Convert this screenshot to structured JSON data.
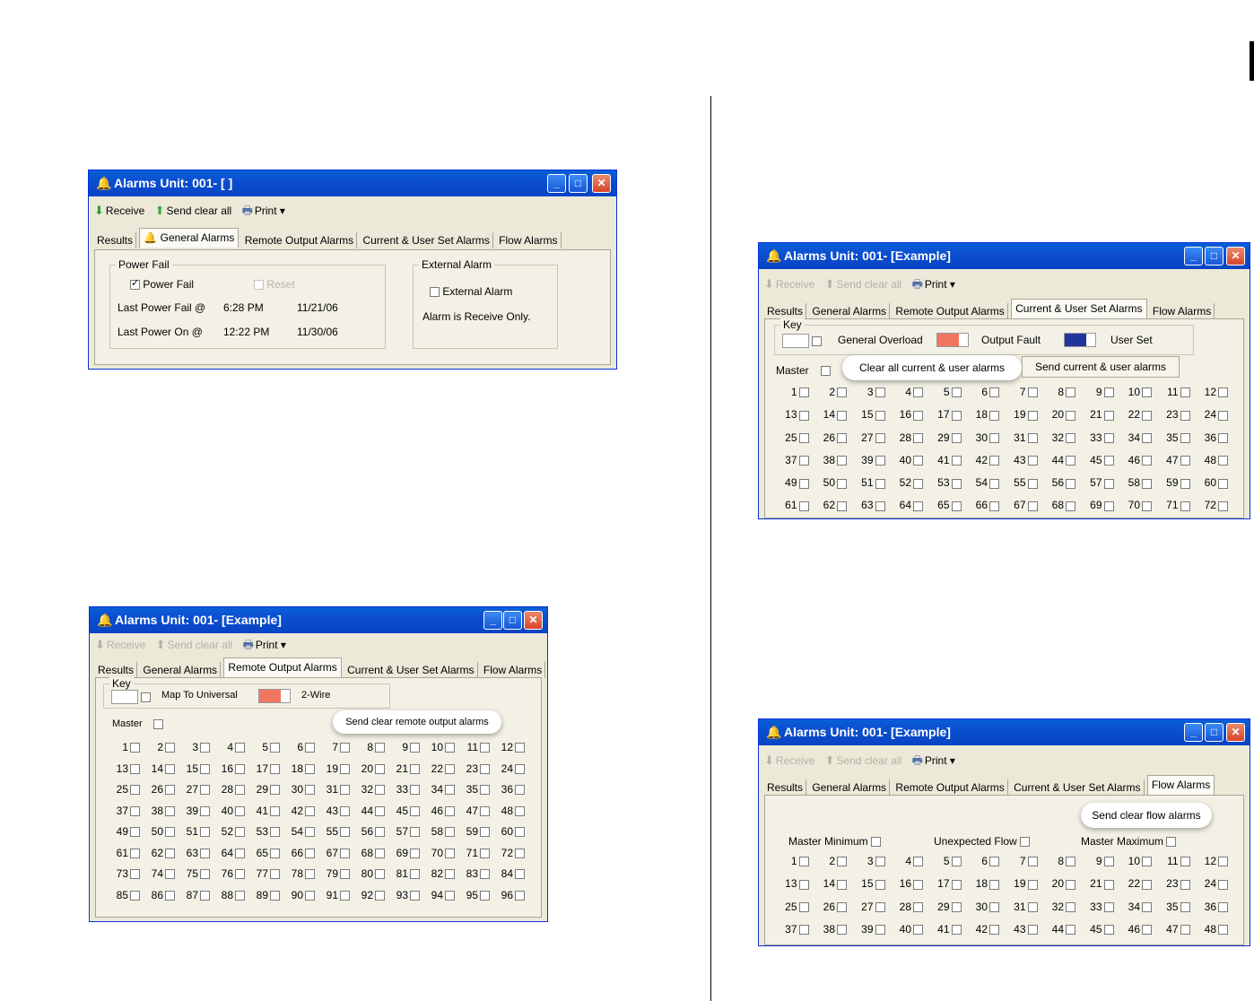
{
  "window_common": {
    "toolbar": {
      "receive": "Receive",
      "send_clear_all": "Send clear all",
      "print": "Print"
    },
    "tabs": [
      "Results",
      "General Alarms",
      "Remote Output Alarms",
      "Current & User Set Alarms",
      "Flow Alarms"
    ]
  },
  "win1": {
    "title": "Alarms Unit: 001- [ ]",
    "power_fail_group": {
      "title": "Power Fail",
      "power_fail_check": "Power Fail",
      "reset_check": "Reset",
      "last_fail_label": "Last Power Fail @",
      "last_fail_time": "6:28 PM",
      "last_fail_date": "11/21/06",
      "last_on_label": "Last Power On @",
      "last_on_time": "12:22 PM",
      "last_on_date": "11/30/06"
    },
    "external_group": {
      "title": "External Alarm",
      "external_check": "External Alarm",
      "note": "Alarm is Receive Only."
    }
  },
  "win2": {
    "title": "Alarms Unit: 001- [Example]",
    "key_title": "Key",
    "key_map": "Map To Universal",
    "key_2wire": "2-Wire",
    "master": "Master",
    "send_button": "Send clear remote output alarms",
    "outputs": 96
  },
  "win3": {
    "title": "Alarms Unit: 001- [Example]",
    "key_title": "Key",
    "key_general_overload": "General Overload",
    "key_output_fault": "Output Fault",
    "key_user_set": "User Set",
    "master": "Master",
    "clear_button": "Clear all current & user alarms",
    "send_button": "Send current & user alarms",
    "outputs": 72
  },
  "win4": {
    "title": "Alarms Unit: 001- [Example]",
    "send_button": "Send clear flow alarms",
    "master_minimum": "Master Minimum",
    "unexpected_flow": "Unexpected Flow",
    "master_maximum": "Master Maximum",
    "outputs": 48
  },
  "colors": {
    "titlebar": "#0a5fd8",
    "output_fault": "#f0775e",
    "user_set": "#21349a",
    "window_bg": "#ece9d8"
  },
  "icons": {
    "receive": "arrow-down-icon",
    "send": "arrow-up-icon",
    "print": "printer-icon",
    "alarm": "bell-icon"
  }
}
